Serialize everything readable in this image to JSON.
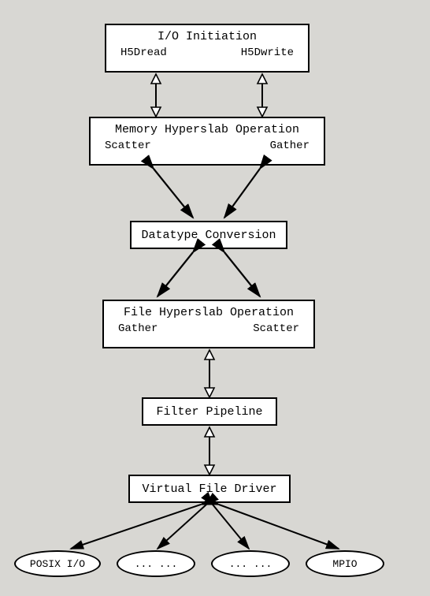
{
  "diagram": {
    "io_init": {
      "title": "I/O Initiation",
      "left": "H5Dread",
      "right": "H5Dwrite"
    },
    "mem_hyperslab": {
      "title": "Memory Hyperslab Operation",
      "left": "Scatter",
      "right": "Gather"
    },
    "datatype_conv": {
      "title": "Datatype Conversion"
    },
    "file_hyperslab": {
      "title": "File Hyperslab Operation",
      "left": "Gather",
      "right": "Scatter"
    },
    "filter_pipeline": {
      "title": "Filter Pipeline"
    },
    "vfd": {
      "title": "Virtual File Driver"
    },
    "drivers": {
      "posix": "POSIX I/O",
      "d2": "... ...",
      "d3": "... ...",
      "mpio": "MPIO"
    }
  }
}
